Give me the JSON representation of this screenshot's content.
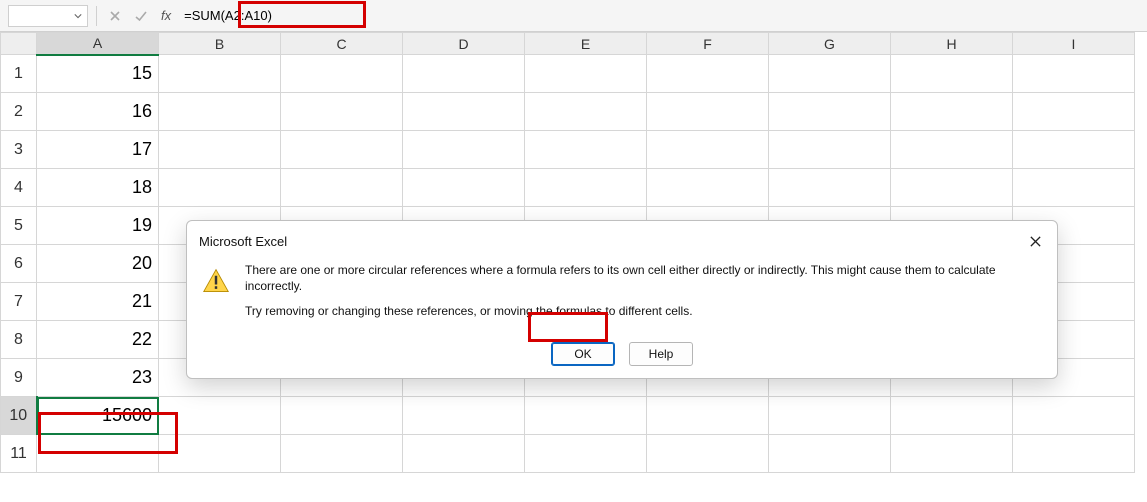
{
  "formula_bar": {
    "name_box": "",
    "fx_label": "fx",
    "formula": "=SUM(A2:A10)"
  },
  "columns": [
    "A",
    "B",
    "C",
    "D",
    "E",
    "F",
    "G",
    "H",
    "I"
  ],
  "rows": [
    {
      "n": "1",
      "A": "15"
    },
    {
      "n": "2",
      "A": "16"
    },
    {
      "n": "3",
      "A": "17"
    },
    {
      "n": "4",
      "A": "18"
    },
    {
      "n": "5",
      "A": "19"
    },
    {
      "n": "6",
      "A": "20"
    },
    {
      "n": "7",
      "A": "21"
    },
    {
      "n": "8",
      "A": "22"
    },
    {
      "n": "9",
      "A": "23"
    },
    {
      "n": "10",
      "A": "15600"
    },
    {
      "n": "11",
      "A": ""
    }
  ],
  "active": {
    "col": "A",
    "row": "10"
  },
  "dialog": {
    "title": "Microsoft Excel",
    "line1": "There are one or more circular references where a formula refers to its own cell either directly or indirectly. This might cause them to calculate incorrectly.",
    "line2": "Try removing or changing these references, or moving the formulas to different cells.",
    "ok": "OK",
    "help": "Help"
  }
}
